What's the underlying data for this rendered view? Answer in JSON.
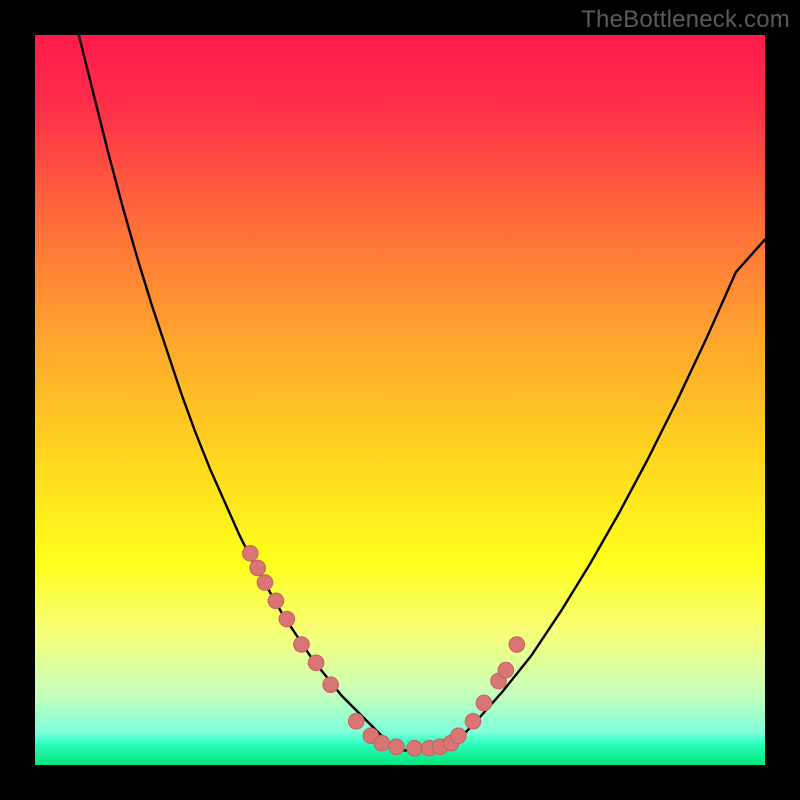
{
  "watermark": "TheBottleneck.com",
  "colors": {
    "frame": "#000000",
    "gradient_stops": [
      {
        "offset": 0.0,
        "color": "#ff1a4b"
      },
      {
        "offset": 0.1,
        "color": "#ff2f49"
      },
      {
        "offset": 0.25,
        "color": "#ff6a3a"
      },
      {
        "offset": 0.42,
        "color": "#ffa62d"
      },
      {
        "offset": 0.58,
        "color": "#ffd61f"
      },
      {
        "offset": 0.72,
        "color": "#ffff1a"
      },
      {
        "offset": 0.82,
        "color": "#f6ff7a"
      },
      {
        "offset": 0.9,
        "color": "#c8ffb9"
      },
      {
        "offset": 0.955,
        "color": "#7fffda"
      },
      {
        "offset": 0.97,
        "color": "#2fffc0"
      },
      {
        "offset": 1.0,
        "color": "#00e57a"
      }
    ],
    "curve": "#000000",
    "dot_fill": "#d97575",
    "dot_stroke": "#c95e5e"
  },
  "chart_data": {
    "type": "line",
    "title": "",
    "xlabel": "",
    "ylabel": "",
    "xlim": [
      0,
      100
    ],
    "ylim": [
      0,
      100
    ],
    "x": [
      6,
      8,
      10,
      12,
      14,
      16,
      18,
      20,
      22,
      24,
      26,
      28,
      30,
      32,
      34,
      36,
      38,
      40,
      42,
      44,
      46,
      48,
      50,
      52,
      54,
      56,
      58,
      60,
      64,
      68,
      72,
      76,
      80,
      84,
      88,
      92,
      96,
      100
    ],
    "y": [
      100,
      92,
      84,
      76.5,
      69.5,
      63,
      57,
      51,
      45.5,
      40.5,
      36,
      31.5,
      27.5,
      24,
      20.5,
      17.5,
      14.5,
      12,
      9.5,
      7.5,
      5.5,
      3.5,
      2,
      2,
      2,
      2,
      3.5,
      5.5,
      10,
      15,
      21,
      27.5,
      34.5,
      42,
      50,
      58.5,
      67.5,
      72
    ],
    "markers": {
      "x": [
        29.5,
        30.5,
        31.5,
        33,
        34.5,
        36.5,
        38.5,
        40.5,
        44,
        46,
        47.5,
        49.5,
        52,
        54,
        55.5,
        57,
        58,
        60,
        61.5,
        63.5,
        64.5,
        66
      ],
      "y": [
        29,
        27,
        25,
        22.5,
        20,
        16.5,
        14,
        11,
        6,
        4,
        3,
        2.5,
        2.3,
        2.3,
        2.5,
        3,
        4,
        6,
        8.5,
        11.5,
        13,
        16.5
      ]
    }
  }
}
